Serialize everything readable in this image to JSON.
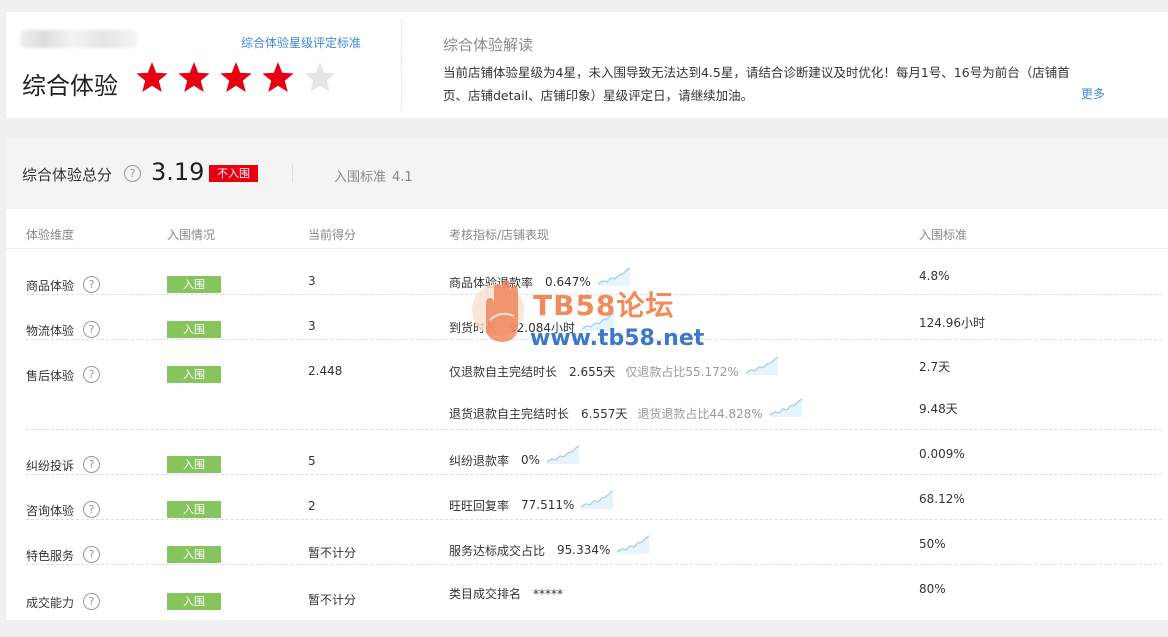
{
  "header": {
    "standard_link": "综合体验星级评定标准",
    "overall_label": "综合体验",
    "stars_filled": 4,
    "stars_total": 5,
    "interpret_title": "综合体验解读",
    "interpret_text": "当前店铺体验星级为4星，未入围导致无法达到4.5星，请结合诊断建议及时优化！每月1号、16号为前台（店铺首页、店铺detail、店铺印象）星级评定日，请继续加油。",
    "more_link": "更多"
  },
  "score": {
    "label": "综合体验总分",
    "value": "3.19",
    "status_badge": "不入围",
    "standard_label": "入围标准",
    "standard_value": "4.1"
  },
  "table": {
    "headers": [
      "体验维度",
      "入围情况",
      "当前得分",
      "考核指标/店铺表现",
      "入围标准"
    ],
    "rows": [
      {
        "dimension": "商品体验",
        "status": "入围",
        "score": "3",
        "metrics": [
          {
            "name": "商品体验退款率",
            "value": "0.647%",
            "extra": "",
            "standard": "4.8%"
          }
        ]
      },
      {
        "dimension": "物流体验",
        "status": "入围",
        "score": "3",
        "metrics": [
          {
            "name": "到货时长",
            "value": "92.084小时",
            "extra": "",
            "standard": "124.96小时"
          }
        ]
      },
      {
        "dimension": "售后体验",
        "status": "入围",
        "score": "2.448",
        "metrics": [
          {
            "name": "仅退款自主完结时长",
            "value": "2.655天",
            "extra": "仅退款占比55.172%",
            "standard": "2.7天"
          },
          {
            "name": "退货退款自主完结时长",
            "value": "6.557天",
            "extra": "退货退款占比44.828%",
            "standard": "9.48天"
          }
        ]
      },
      {
        "dimension": "纠纷投诉",
        "status": "入围",
        "score": "5",
        "metrics": [
          {
            "name": "纠纷退款率",
            "value": "0%",
            "extra": "",
            "standard": "0.009%"
          }
        ]
      },
      {
        "dimension": "咨询体验",
        "status": "入围",
        "score": "2",
        "metrics": [
          {
            "name": "旺旺回复率",
            "value": "77.511%",
            "extra": "",
            "standard": "68.12%"
          }
        ]
      },
      {
        "dimension": "特色服务",
        "status": "入围",
        "score": "暂不计分",
        "metrics": [
          {
            "name": "服务达标成交占比",
            "value": "95.334%",
            "extra": "",
            "standard": "50%"
          }
        ]
      },
      {
        "dimension": "成交能力",
        "status": "入围",
        "score": "暂不计分",
        "metrics": [
          {
            "name": "类目成交排名",
            "value": "*****",
            "extra": "",
            "standard": "80%"
          }
        ]
      }
    ]
  },
  "watermark": {
    "title": "TB58论坛",
    "url": "www.tb58.net"
  },
  "colors": {
    "star_filled": "#e60012",
    "star_empty": "#e5e5e5",
    "badge_in": "#86c45d",
    "badge_out": "#e60012",
    "link": "#3e8ad8"
  }
}
